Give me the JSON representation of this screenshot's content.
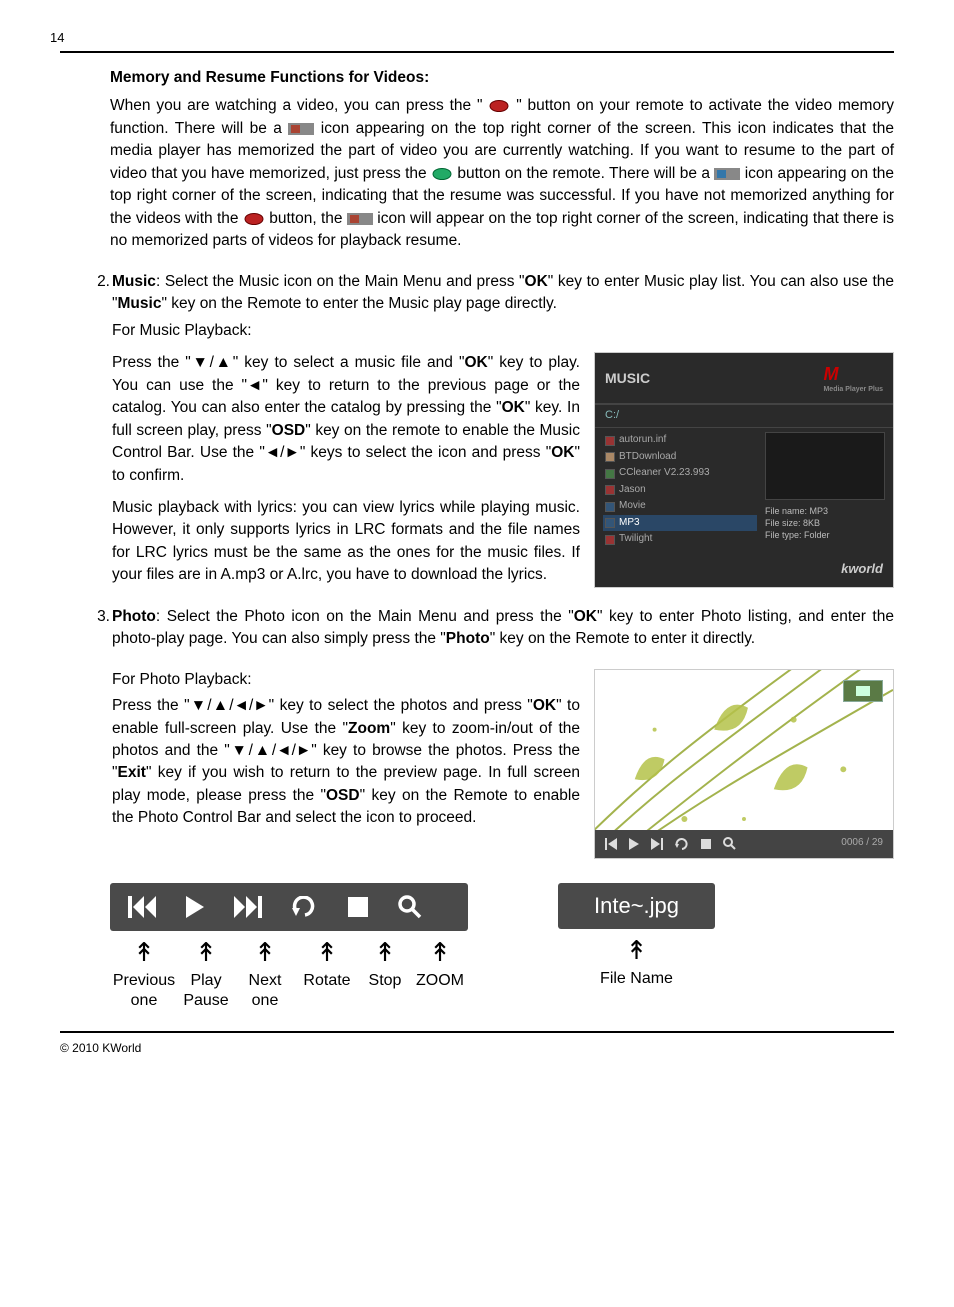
{
  "page_number": "14",
  "footer": "© 2010 KWorld",
  "memory": {
    "heading": "Memory and Resume Functions for Videos:",
    "p1a": "When you are watching a video, you can press the \" ",
    "p1b": " \" button on your remote to activate the video memory function. There will be a ",
    "p1c": " icon appearing on the top right corner of the screen. This icon indicates that the media player has memorized the part of video you are currently watching. If you want to resume to the part of video that you have memorized, just press the ",
    "p1d": " button on the remote. There will be a ",
    "p1e": " icon appearing on the top right corner of the screen, indicating that the resume was successful. If you have not memorized anything for the videos with the ",
    "p1f": " button, the ",
    "p1g": " icon will appear on the top right corner of the screen, indicating that there is no memorized parts of videos for playback resume."
  },
  "music": {
    "num": "2.",
    "label_bold": "Music",
    "intro_a": ": Select the Music icon on the Main Menu and press \"",
    "ok": "OK",
    "intro_b": "\" key to enter Music play list. You can also use the \"",
    "music_key": "Music",
    "intro_c": "\" key on the Remote to enter the Music play page directly.",
    "for_playback": "For Music Playback:",
    "p2a": "Press the \"▼/▲\" key to select a music file and \"",
    "p2b": "\" key to play. You can use the \"◄\" key to return to the previous page or the catalog. You can also enter the catalog by pressing the \"",
    "p2c": "\" key. In full screen play, press \"",
    "osd": "OSD",
    "p2d": "\" key on the remote to enable the Music Control Bar. Use the \"◄/►\" keys to select the icon and press \"",
    "p2e": "\" to confirm.",
    "p3": "Music playback with lyrics: you can view lyrics while playing music. However, it only supports lyrics in LRC formats and the file names for LRC lyrics must be the same as the ones for the music files. If your files are in A.mp3 or A.lrc, you have to download the lyrics."
  },
  "music_shot": {
    "title": "MUSIC",
    "bread": "C:/",
    "items": [
      "autorun.inf",
      "BTDownload",
      "CCleaner V2.23.993",
      "Jason",
      "Movie",
      "MP3",
      "Twilight"
    ],
    "meta1": "File name: MP3",
    "meta2": "File size: 8KB",
    "meta3": "File type: Folder",
    "brand": "kworld"
  },
  "photo": {
    "num": "3.",
    "label_bold": "Photo",
    "intro_a": ": Select the Photo icon on the Main Menu and press the \"",
    "ok": "OK",
    "intro_b": "\" key to enter Photo listing, and enter the photo-play page. You can also simply press the \"",
    "photo_key": "Photo",
    "intro_c": "\" key on the Remote to enter it directly.",
    "for_playback": "For Photo Playback:",
    "p2a": "Press the \"▼/▲/◄/►\" key to select the photos and press \"",
    "p2b": "\" to enable full-screen play. Use the \"",
    "zoom": "Zoom",
    "p2c": "\" key to zoom-in/out of the photos and the \"▼/▲/◄/►\" key to browse the photos. Press the \"",
    "exit": "Exit",
    "p2d": "\" key if you wish to return to the preview page. In full screen play mode, please press the \"",
    "osd": "OSD",
    "p2e": "\" key on the Remote to enable the Photo Control Bar and select the icon to proceed."
  },
  "photo_shot": {
    "fname_bar": "Inte~.jpg",
    "counter": "0006 / 29"
  },
  "controls": {
    "bar_fname": "Inte~.jpg",
    "labels": [
      "Previous one",
      "Play Pause",
      "Next one",
      "Rotate",
      "Stop",
      "ZOOM"
    ],
    "file_label": "File Name"
  }
}
